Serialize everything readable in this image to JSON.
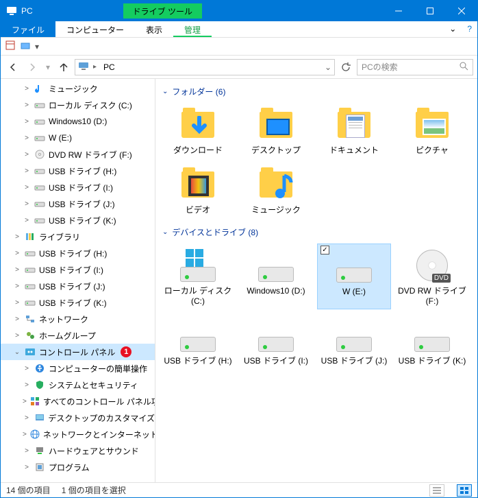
{
  "title": "PC",
  "context_tab": "ドライブ ツール",
  "ribbon": {
    "file": "ファイル",
    "computer": "コンピューター",
    "view": "表示",
    "manage": "管理"
  },
  "address": {
    "location": "PC"
  },
  "search": {
    "placeholder": "PCの検索"
  },
  "tree": [
    {
      "label": "ミュージック",
      "depth": 2,
      "icon": "music"
    },
    {
      "label": "ローカル ディスク (C:)",
      "depth": 2,
      "icon": "drive"
    },
    {
      "label": "Windows10 (D:)",
      "depth": 2,
      "icon": "drive"
    },
    {
      "label": "W (E:)",
      "depth": 2,
      "icon": "drive"
    },
    {
      "label": "DVD RW ドライブ (F:)",
      "depth": 2,
      "icon": "dvd"
    },
    {
      "label": "USB ドライブ (H:)",
      "depth": 2,
      "icon": "drive"
    },
    {
      "label": "USB ドライブ (I:)",
      "depth": 2,
      "icon": "drive"
    },
    {
      "label": "USB ドライブ (J:)",
      "depth": 2,
      "icon": "drive"
    },
    {
      "label": "USB ドライブ (K:)",
      "depth": 2,
      "icon": "drive"
    },
    {
      "label": "ライブラリ",
      "depth": 1,
      "icon": "library"
    },
    {
      "label": "USB ドライブ (H:)",
      "depth": 1,
      "icon": "drive"
    },
    {
      "label": "USB ドライブ (I:)",
      "depth": 1,
      "icon": "drive"
    },
    {
      "label": "USB ドライブ (J:)",
      "depth": 1,
      "icon": "drive"
    },
    {
      "label": "USB ドライブ (K:)",
      "depth": 1,
      "icon": "drive"
    },
    {
      "label": "ネットワーク",
      "depth": 1,
      "icon": "network"
    },
    {
      "label": "ホームグループ",
      "depth": 1,
      "icon": "homegroup"
    },
    {
      "label": "コントロール パネル",
      "depth": 1,
      "icon": "control",
      "selected": true,
      "expanded": true,
      "marker": "1"
    },
    {
      "label": "コンピューターの簡単操作",
      "depth": 2,
      "icon": "ease"
    },
    {
      "label": "システムとセキュリティ",
      "depth": 2,
      "icon": "security"
    },
    {
      "label": "すべてのコントロール パネル項目",
      "depth": 2,
      "icon": "allcp"
    },
    {
      "label": "デスクトップのカスタマイズ",
      "depth": 2,
      "icon": "customize"
    },
    {
      "label": "ネットワークとインターネット",
      "depth": 2,
      "icon": "netint"
    },
    {
      "label": "ハードウェアとサウンド",
      "depth": 2,
      "icon": "hardware"
    },
    {
      "label": "プログラム",
      "depth": 2,
      "icon": "programs"
    }
  ],
  "groups": {
    "folders": {
      "title": "フォルダー",
      "count": 6
    },
    "drives": {
      "title": "デバイスとドライブ",
      "count": 8
    }
  },
  "folders": [
    {
      "label": "ダウンロード",
      "icon": "download"
    },
    {
      "label": "デスクトップ",
      "icon": "desktop"
    },
    {
      "label": "ドキュメント",
      "icon": "document"
    },
    {
      "label": "ピクチャ",
      "icon": "picture"
    },
    {
      "label": "ビデオ",
      "icon": "video"
    },
    {
      "label": "ミュージック",
      "icon": "music"
    }
  ],
  "drives": [
    {
      "label": "ローカル ディスク (C:)",
      "icon": "drive-win"
    },
    {
      "label": "Windows10 (D:)",
      "icon": "drive"
    },
    {
      "label": "W (E:)",
      "icon": "drive",
      "selected": true
    },
    {
      "label": "DVD RW ドライブ (F:)",
      "icon": "dvd"
    },
    {
      "label": "USB ドライブ (H:)",
      "icon": "drive"
    },
    {
      "label": "USB ドライブ (I:)",
      "icon": "drive"
    },
    {
      "label": "USB ドライブ (J:)",
      "icon": "drive"
    },
    {
      "label": "USB ドライブ (K:)",
      "icon": "drive"
    }
  ],
  "status": {
    "item_count": "14 個の項目",
    "selection": "1 個の項目を選択"
  }
}
